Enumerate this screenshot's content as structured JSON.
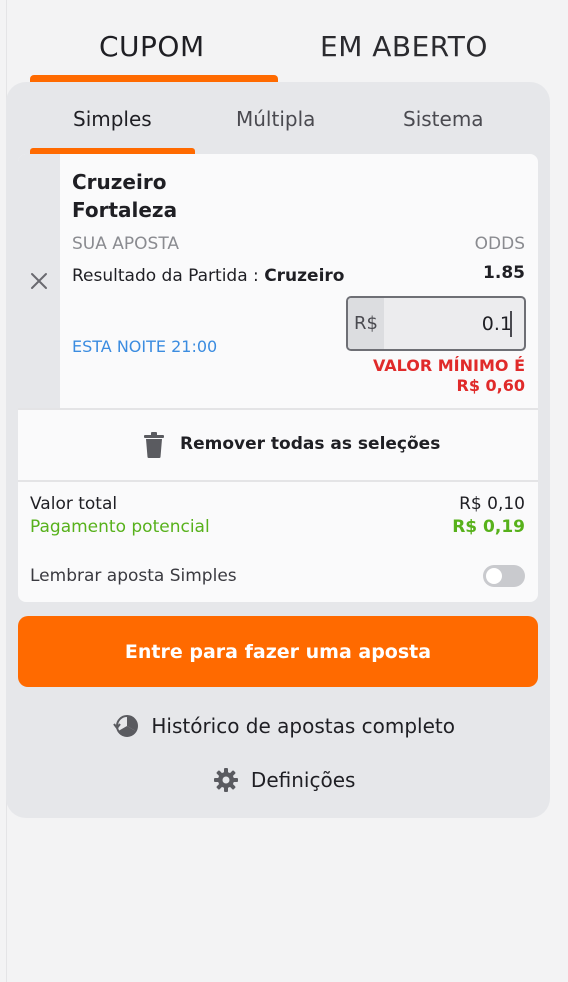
{
  "top_tabs": {
    "coupon": "CUPOM",
    "open": "EM ABERTO",
    "active": "coupon"
  },
  "bet_tabs": {
    "simple": "Simples",
    "multiple": "Múltipla",
    "system": "Sistema",
    "active": "simple"
  },
  "selection": {
    "home_team": "Cruzeiro",
    "away_team": "Fortaleza",
    "your_bet_label": "SUA APOSTA",
    "odds_label": "ODDS",
    "market": "Resultado da Partida :",
    "pick": "Cruzeiro",
    "odds": "1.85",
    "time": "ESTA NOITE 21:00",
    "currency": "R$",
    "stake": "0.1",
    "min_warning_line1": "VALOR MÍNIMO É",
    "min_warning_line2": "R$ 0,60"
  },
  "remove_all": {
    "label": "Remover todas as seleções",
    "icon": "trash-icon"
  },
  "summary": {
    "total_label": "Valor total",
    "total_value": "R$ 0,10",
    "potential_label": "Pagamento potencial",
    "potential_value": "R$ 0,19",
    "remember_label": "Lembrar aposta Simples",
    "remember_on": false
  },
  "cta": {
    "label": "Entre para fazer uma aposta"
  },
  "links": {
    "history": "Histórico de apostas completo",
    "settings": "Definições"
  },
  "colors": {
    "accent": "#ff6a00",
    "positive": "#57b11b",
    "error": "#e02a2a",
    "info": "#3b8ce0"
  }
}
